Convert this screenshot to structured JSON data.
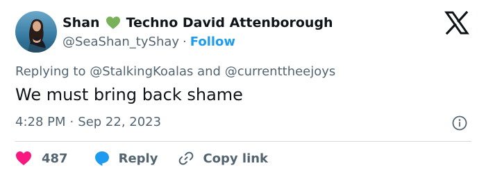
{
  "author": {
    "display_name_first": "Shan",
    "display_name_rest": "Techno David Attenborough",
    "emoji_icon": "green-heart-emoji",
    "handle": "@SeaShan_tyShay",
    "separator": "·",
    "follow_label": "Follow"
  },
  "platform_icon": "x-logo-icon",
  "reply_context": {
    "prefix": "Replying to",
    "mention_1": "@StalkingKoalas",
    "conjunction": "and",
    "mention_2": "@currenttheejoys"
  },
  "tweet": {
    "text": "We must bring back shame",
    "time": "4:28 PM",
    "separator": "·",
    "date": "Sep 22, 2023"
  },
  "actions": {
    "like_count": "487",
    "reply_label": "Reply",
    "copy_link_label": "Copy link"
  },
  "colors": {
    "accent": "#1d9bf0",
    "heart": "#f91880",
    "reply_bubble": "#1d9bf0",
    "secondary_text": "#536471",
    "green_heart": "#78b159"
  }
}
